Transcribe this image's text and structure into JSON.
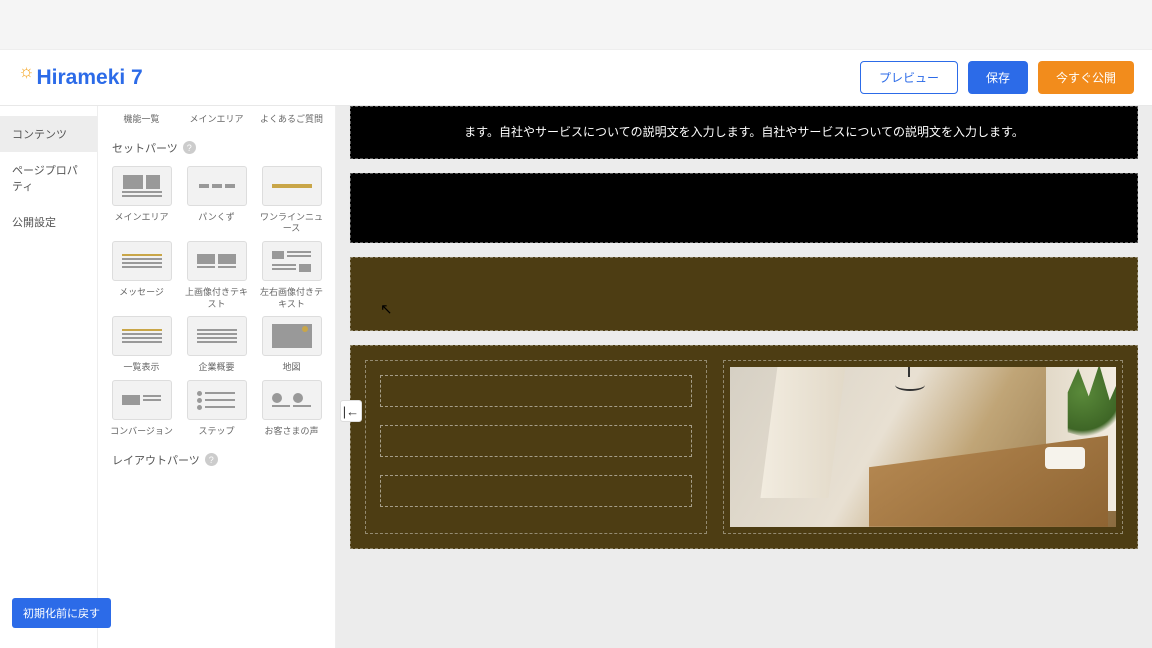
{
  "header": {
    "logo_text": "irameki 7",
    "preview": "プレビュー",
    "save": "保存",
    "publish": "今すぐ公開"
  },
  "leftnav": {
    "items": [
      "コンテンツ",
      "ページプロパティ",
      "公開設定"
    ],
    "active_index": 0
  },
  "parts_panel": {
    "top_row": [
      "機能一覧",
      "メインエリア",
      "よくあるご質問"
    ],
    "section_set_parts": "セットパーツ",
    "set_parts": [
      [
        "メインエリア",
        "パンくず",
        "ワンラインニュース"
      ],
      [
        "メッセージ",
        "上画像付きテキスト",
        "左右画像付きテキスト"
      ],
      [
        "一覧表示",
        "企業概要",
        "地図"
      ],
      [
        "コンバージョン",
        "ステップ",
        "お客さまの声"
      ]
    ],
    "section_layout_parts": "レイアウトパーツ"
  },
  "canvas": {
    "hero_text": "ます。自社やサービスについての説明文を入力します。自社やサービスについての説明文を入力します。"
  },
  "buttons": {
    "reset": "初期化前に戻す",
    "collapse": "|←"
  }
}
